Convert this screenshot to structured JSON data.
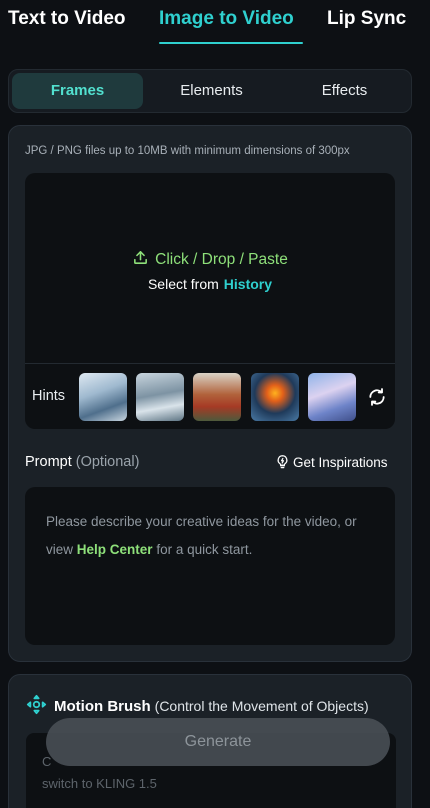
{
  "top_tabs": [
    {
      "label": "Text to Video",
      "active": false
    },
    {
      "label": "Image to Video",
      "active": true
    },
    {
      "label": "Lip Sync",
      "active": false
    }
  ],
  "sub_tabs": [
    {
      "label": "Frames",
      "active": true
    },
    {
      "label": "Elements",
      "active": false
    },
    {
      "label": "Effects",
      "active": false
    }
  ],
  "upload": {
    "note": "JPG / PNG files up to 10MB with minimum dimensions of 300px",
    "action_label": "Click / Drop / Paste",
    "select_from": "Select from",
    "history_link": "History"
  },
  "hints": {
    "label": "Hints",
    "thumbnail_count": 5
  },
  "prompt": {
    "label": "Prompt",
    "optional": "(Optional)",
    "inspiration_button": "Get Inspirations",
    "placeholder_before": "Please describe your creative ideas for the video, or view",
    "help_link": "Help Center",
    "placeholder_after": "for a quick start."
  },
  "motion_brush": {
    "title": "Motion Brush",
    "subtitle": "(Control the Movement of Objects)",
    "body_line1": "C",
    "body_line2": "switch to KLING 1.5"
  },
  "generate_button": "Generate",
  "colors": {
    "accent_teal": "#2fd0cf",
    "accent_green": "#8ee07a",
    "background": "#0d1014",
    "panel": "#1b2127"
  },
  "icons": {
    "upload": "upload-icon",
    "refresh": "refresh-icon",
    "inspiration": "lightbulb-icon",
    "motion_brush": "motion-brush-icon"
  }
}
